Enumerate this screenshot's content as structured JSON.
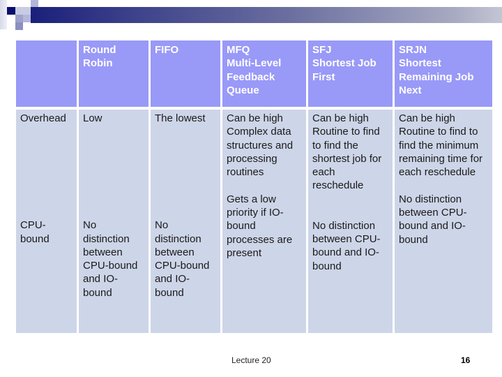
{
  "slide": {
    "table": {
      "headers": [
        "",
        "Round\nRobin",
        "FIFO",
        "MFQ\nMulti-Level\nFeedback\nQueue",
        "SFJ\nShortest Job\nFirst",
        "SRJN\nShortest\nRemaining Job\nNext"
      ],
      "rows": [
        {
          "label": "Overhead",
          "cells": [
            "Low",
            "The lowest",
            "Can be high\nComplex data structures and processing routines",
            "Can be high\nRoutine to find to find the shortest job for each reschedule",
            "Can be high\nRoutine to find to find the minimum remaining time for each reschedule"
          ]
        },
        {
          "label": "CPU-bound",
          "cells": [
            "No distinction between CPU-bound and IO-bound",
            "No distinction between CPU-bound and IO-bound",
            "Gets a low priority if IO-bound processes are present",
            "No distinction between CPU-bound and IO-bound",
            "No distinction between CPU-bound and IO-bound"
          ]
        }
      ]
    },
    "footer": {
      "lecture": "Lecture 20",
      "page_number": "16"
    },
    "colors": {
      "header_fill": "#9999f8",
      "body_fill": "#cdd5e8",
      "banner_dark": "#1a1f7a"
    }
  }
}
